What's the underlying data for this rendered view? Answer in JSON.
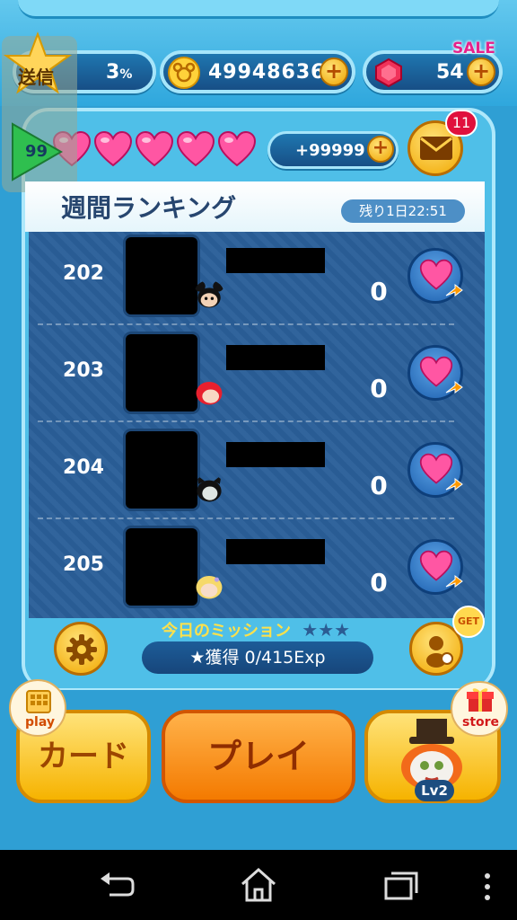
{
  "top_bar": {
    "send_label": "送信",
    "exp_percent": "3",
    "exp_unit": "%",
    "level": "99",
    "coins": "49948636",
    "gems": "54",
    "sale_label": "SALE",
    "extra_hearts": "+99999",
    "mail_badge": "11"
  },
  "ranking": {
    "title": "週間ランキング",
    "remaining": "残り1日22:51",
    "rows": [
      {
        "rank": "202",
        "score": "0",
        "tsum": "mickey"
      },
      {
        "rank": "203",
        "score": "0",
        "tsum": "ariel"
      },
      {
        "rank": "204",
        "score": "0",
        "tsum": "maleficent"
      },
      {
        "rank": "205",
        "score": "0",
        "tsum": "rapunzel"
      }
    ]
  },
  "mission": {
    "title": "今日のミッション",
    "stars": "★★★",
    "progress": "★獲得 0/415Exp",
    "get_label": "GET"
  },
  "bottom": {
    "card_label": "カード",
    "card_badge": "play",
    "play_label": "プレイ",
    "store_badge": "store",
    "level_badge": "Lv2"
  },
  "colors": {
    "heart": "#ff4f9e",
    "panel": "#4fbfe8",
    "ranking_bg": "#2a5f99",
    "gold": "#f6b300",
    "orange": "#f47a00"
  },
  "icons": {
    "settings": "gear-icon",
    "friend": "friend-add-icon",
    "mail": "mail-icon",
    "nav_back": "back-icon",
    "nav_home": "home-icon",
    "nav_recents": "recents-icon",
    "nav_menu": "menu-icon"
  }
}
